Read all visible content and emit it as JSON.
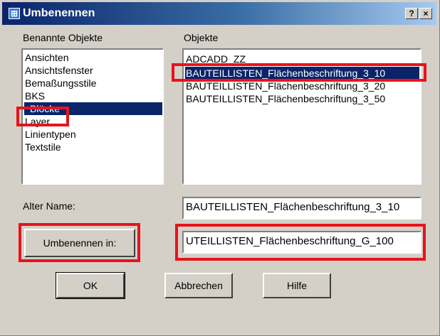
{
  "window": {
    "title": "Umbenennen",
    "help_button": "?",
    "close_button": "×"
  },
  "named_objects": {
    "label": "Benannte Objekte",
    "items": [
      "Ansichten",
      "Ansichtsfenster",
      "Bemaßungsstile",
      "BKS",
      "Blöcke",
      "Layer",
      "Linientypen",
      "Textstile"
    ],
    "selected_item": "Blöcke"
  },
  "objects": {
    "label": "Objekte",
    "items": [
      "ADCADD_ZZ",
      "BAUTEILLISTEN_Flächenbeschriftung_3_10",
      "BAUTEILLISTEN_Flächenbeschriftung_3_20",
      "BAUTEILLISTEN_Flächenbeschriftung_3_50"
    ],
    "selected_item": "BAUTEILLISTEN_Flächenbeschriftung_3_10"
  },
  "old_name": {
    "label": "Alter Name:",
    "value": "BAUTEILLISTEN_Flächenbeschriftung_3_10"
  },
  "rename_to": {
    "button_label": "Umbenennen in:",
    "value": "UTEILLISTEN_Flächenbeschriftung_G_100"
  },
  "buttons": {
    "ok": "OK",
    "cancel": "Abbrechen",
    "help": "Hilfe"
  },
  "colors": {
    "highlight": "#e8131b",
    "selection": "#0a246a",
    "dialog_face": "#d4d0c8"
  }
}
